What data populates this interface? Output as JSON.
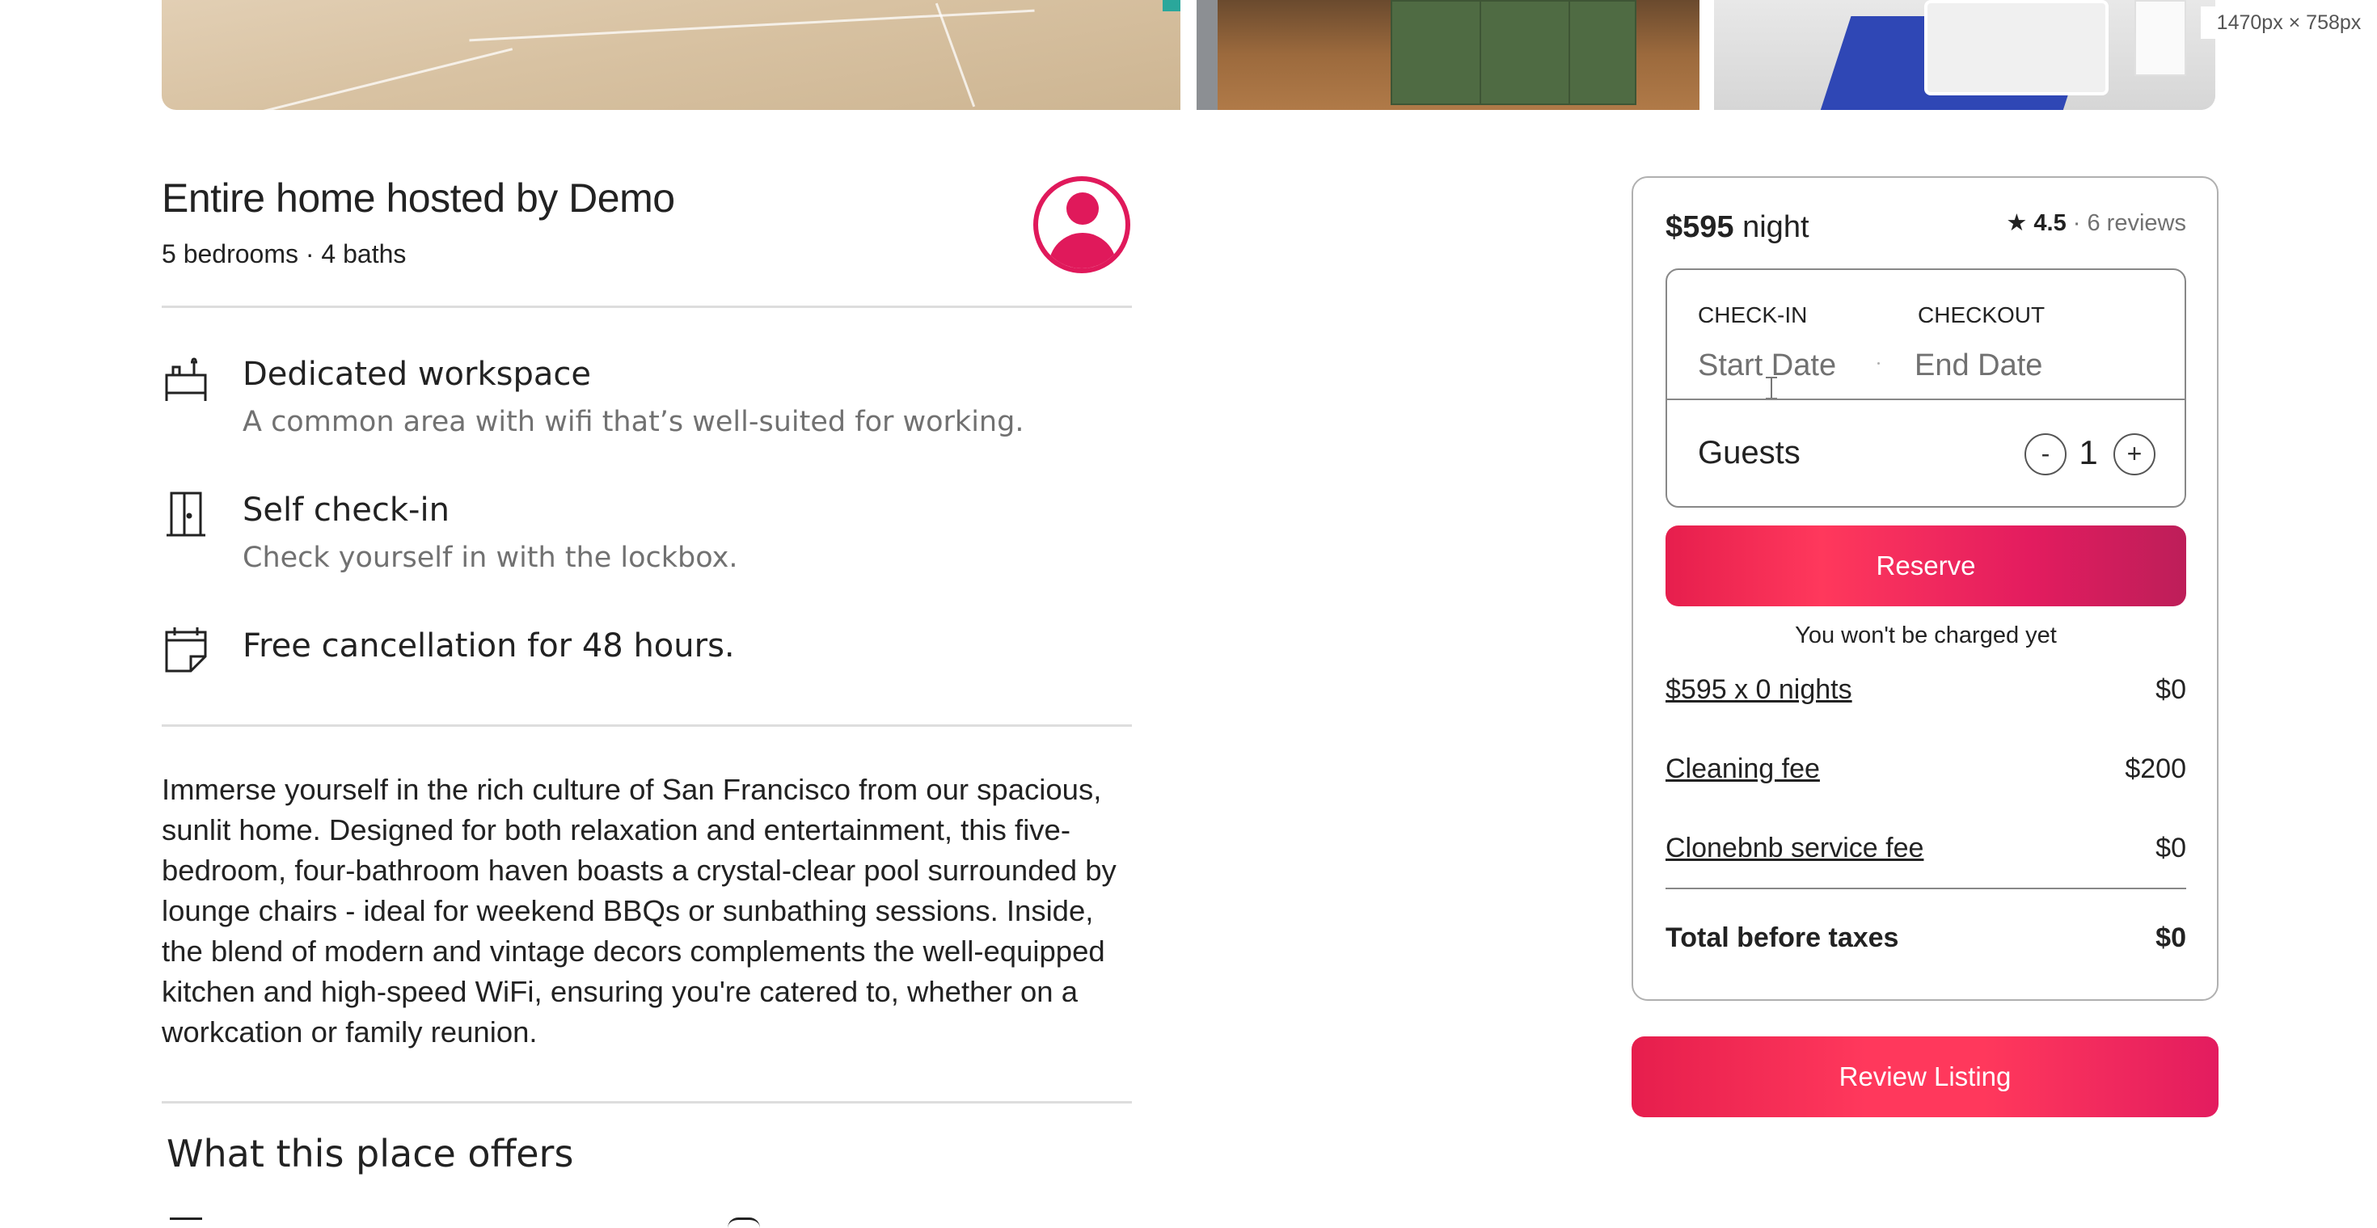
{
  "window": {
    "size_label": "1470px × 758px"
  },
  "listing": {
    "title": "Entire home hosted by Demo",
    "subtitle": "5 bedrooms · 4 baths",
    "features": [
      {
        "icon": "desk-icon",
        "title": "Dedicated workspace",
        "desc": "A common area with wifi that’s well-suited for working."
      },
      {
        "icon": "door-icon",
        "title": "Self check-in",
        "desc": "Check yourself in with the lockbox."
      },
      {
        "icon": "calendar-icon",
        "title": "Free cancellation for 48 hours.",
        "desc": ""
      }
    ],
    "description": "Immerse yourself in the rich culture of San Francisco from our spacious, sunlit home. Designed for both relaxation and entertainment, this five-bedroom, four-bathroom haven boasts a crystal-clear pool surrounded by lounge chairs - ideal for weekend BBQs or sunbathing sessions. Inside, the blend of modern and vintage decors complements the well-equipped kitchen and high-speed WiFi, ensuring you're catered to, whether on a workcation or family reunion.",
    "offers_heading": "What this place offers"
  },
  "booking": {
    "price": "$595",
    "price_unit": "night",
    "rating": "4.5",
    "reviews": "6 reviews",
    "checkin_label": "CHECK-IN",
    "checkout_label": "CHECKOUT",
    "start_placeholder": "Start Date",
    "end_placeholder": "End Date",
    "guests_label": "Guests",
    "guests_minus": "-",
    "guests_count": "1",
    "guests_plus": "+",
    "reserve_label": "Reserve",
    "note": "You won't be charged yet",
    "fees": [
      {
        "label": "$595 x 0 nights",
        "value": "$0"
      },
      {
        "label": "Cleaning fee",
        "value": "$200"
      },
      {
        "label": "Clonebnb service fee",
        "value": "$0"
      }
    ],
    "total_label": "Total before taxes",
    "total_value": "$0",
    "review_listing_label": "Review Listing"
  },
  "colors": {
    "accent": "#e0195b",
    "reserve": "#ff385c",
    "muted": "#717171"
  }
}
